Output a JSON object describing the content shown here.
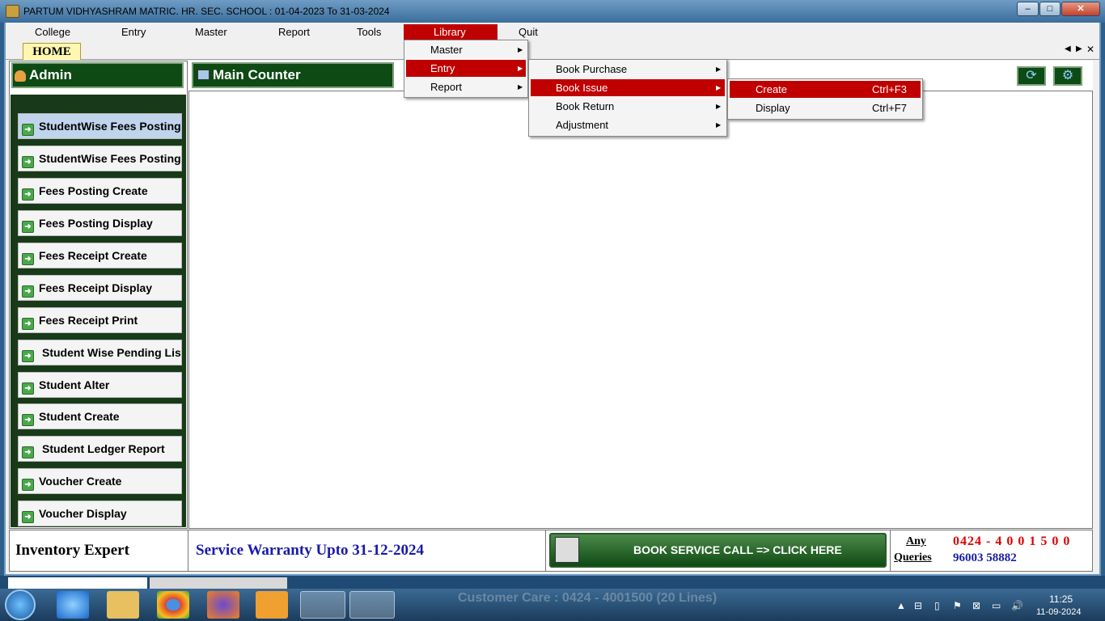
{
  "window": {
    "title": "PARTUM VIDHYASHRAM MATRIC. HR. SEC. SCHOOL  :  01-04-2023 To 31-03-2024"
  },
  "menubar": [
    "College",
    "Entry",
    "Master",
    "Report",
    "Tools",
    "Library",
    "Quit"
  ],
  "tab": {
    "home": "HOME"
  },
  "left": {
    "header": "Admin",
    "items": [
      "StudentWise Fees Posting Create",
      "StudentWise Fees Posting Display",
      "Fees Posting Create",
      "Fees Posting Display",
      "Fees Receipt Create",
      "Fees Receipt Display",
      "Fees Receipt Print",
      "Student Wise Pending List Report",
      "Student Alter",
      "Student Create",
      "Student Ledger Report",
      "Voucher Create",
      "Voucher Display"
    ]
  },
  "main": {
    "header": "Main Counter"
  },
  "library_menu": [
    "Master",
    "Entry",
    "Report"
  ],
  "entry_menu": [
    "Book Purchase",
    "Book Issue",
    "Book Return",
    "Adjustment"
  ],
  "issue_menu": [
    {
      "label": "Create",
      "shortcut": "Ctrl+F3"
    },
    {
      "label": "Display",
      "shortcut": "Ctrl+F7"
    }
  ],
  "footer": {
    "product": "Inventory Expert",
    "warranty": "Service Warranty Upto 31-12-2024",
    "service_button": "BOOK SERVICE CALL => CLICK HERE",
    "any": "Any",
    "queries": "Queries",
    "phone1": "0424 - 4 0 0 1 5 0 0",
    "phone2": "96003 58882"
  },
  "taskbar": {
    "time": "11:25",
    "date": "11-09-2024",
    "ticker": "Customer Care : 0424 - 4001500  (20 Lines)"
  },
  "colors": {
    "accent": "#c00000",
    "panel": "#0e4a14",
    "link": "#1a1aaa"
  }
}
